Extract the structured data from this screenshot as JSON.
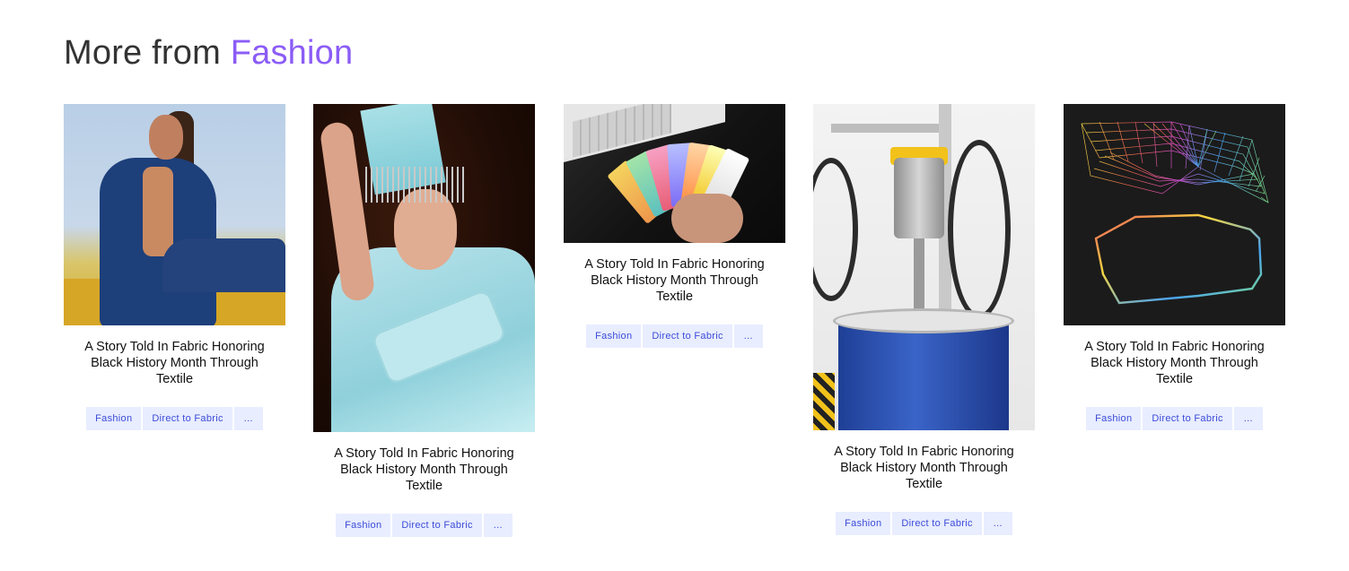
{
  "heading": {
    "prefix": "More from ",
    "accent": "Fashion"
  },
  "colors": {
    "accent": "#8b5cf6",
    "tag_bg": "#e8edff",
    "tag_text": "#3b4bd8"
  },
  "cards": [
    {
      "title": "A Story Told In Fabric Honoring Black History Month Through Textile",
      "image": "model-on-yellow-ledge-photo",
      "tags": [
        "Fashion",
        "Direct to Fabric",
        "..."
      ]
    },
    {
      "title": "A Story Told In Fabric Honoring Black History Month Through Textile",
      "image": "man-with-towel-hat-photo",
      "tags": [
        "Fashion",
        "Direct to Fabric",
        "..."
      ]
    },
    {
      "title": "A Story Told In Fabric Honoring Black History Month Through Textile",
      "image": "keyboard-color-swatches-photo",
      "tags": [
        "Fashion",
        "Direct to Fabric",
        "..."
      ]
    },
    {
      "title": "A Story Told In Fabric Honoring Black History Month Through Textile",
      "image": "industrial-ink-pump-photo",
      "tags": [
        "Fashion",
        "Direct to Fabric",
        "..."
      ]
    },
    {
      "title": "A Story Told In Fabric Honoring Black History Month Through Textile",
      "image": "rainbow-wireframe-render",
      "tags": [
        "Fashion",
        "Direct to Fabric",
        "..."
      ]
    }
  ]
}
